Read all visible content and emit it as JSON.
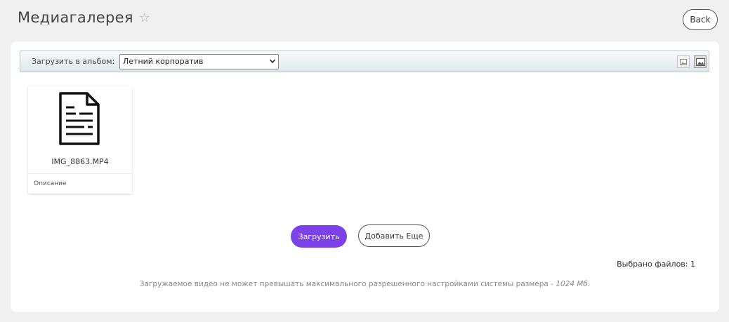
{
  "header": {
    "title": "Медиагалерея",
    "back_label": "Back"
  },
  "toolbar": {
    "upload_to_album_label": "Загрузить в альбом:",
    "album_selected": "Летний корпоратив"
  },
  "files": [
    {
      "name": "IMG_8863.MP4",
      "description_placeholder": "Описание",
      "icon": "document-icon"
    }
  ],
  "actions": {
    "upload_label": "Загрузить",
    "add_more_label": "Добавить Еще"
  },
  "status": {
    "selected_files": "Выбрано файлов: 1"
  },
  "note": {
    "text": "Загружаемое видео не может превышать максимального разрешенного настройками системы размера - ",
    "limit": "1024 Мб",
    "suffix": "."
  },
  "colors": {
    "accent": "#7a42e8",
    "background": "#f0f0f0"
  }
}
